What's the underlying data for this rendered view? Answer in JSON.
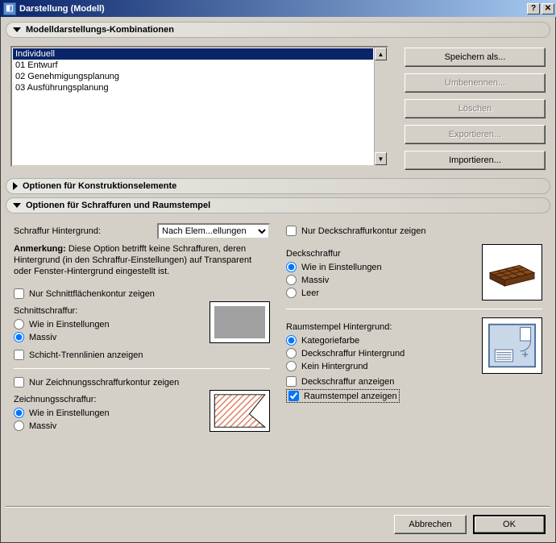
{
  "title": "Darstellung (Modell)",
  "sections": {
    "combos": {
      "label": "Modelldarstellungs-Kombinationen",
      "expanded": true
    },
    "construction": {
      "label": "Optionen für Konstruktionselemente",
      "expanded": false
    },
    "fills": {
      "label": "Optionen für Schraffuren und Raumstempel",
      "expanded": true
    }
  },
  "combos_list": {
    "items": [
      "Individuell",
      "01 Entwurf",
      "02 Genehmigungsplanung",
      "03 Ausführungsplanung"
    ],
    "selected_index": 0
  },
  "buttons": {
    "save_as": "Speichern als...",
    "rename": "Umbenennen...",
    "delete": "Löschen",
    "export": "Exportieren...",
    "import": "Importieren..."
  },
  "left": {
    "fill_bg_label": "Schraffur Hintergrund:",
    "fill_bg_value": "Nach Elem...ellungen",
    "note_label": "Anmerkung:",
    "note_text": " Diese Option betrifft keine Schraffuren, deren Hintergrund (in den Schraffur-Einstellungen) auf Transparent oder Fenster-Hintergrund eingestellt ist.",
    "cut_contour_only": "Nur Schnittflächenkontur zeigen",
    "cut_fill_label": "Schnittschraffur:",
    "cut_fill_opts": {
      "as_settings": "Wie in Einstellungen",
      "solid": "Massiv"
    },
    "layer_sep": "Schicht-Trennlinien anzeigen",
    "draft_contour_only": "Nur Zeichnungsschraffurkontur zeigen",
    "draft_fill_label": "Zeichnungsschraffur:",
    "draft_fill_opts": {
      "as_settings": "Wie in Einstellungen",
      "solid": "Massiv"
    }
  },
  "right": {
    "cover_contour_only": "Nur Deckschraffurkontur zeigen",
    "cover_fill_label": "Deckschraffur",
    "cover_fill_opts": {
      "as_settings": "Wie in Einstellungen",
      "solid": "Massiv",
      "empty": "Leer"
    },
    "zone_bg_label": "Raumstempel Hintergrund:",
    "zone_bg_opts": {
      "category": "Kategoriefarbe",
      "cover": "Deckschraffur Hintergrund",
      "none": "Kein Hintergrund"
    },
    "show_cover": "Deckschraffur anzeigen",
    "show_stamp": "Raumstempel anzeigen"
  },
  "footer": {
    "cancel": "Abbrechen",
    "ok": "OK"
  },
  "win": {
    "help": "?",
    "close": "✕"
  }
}
